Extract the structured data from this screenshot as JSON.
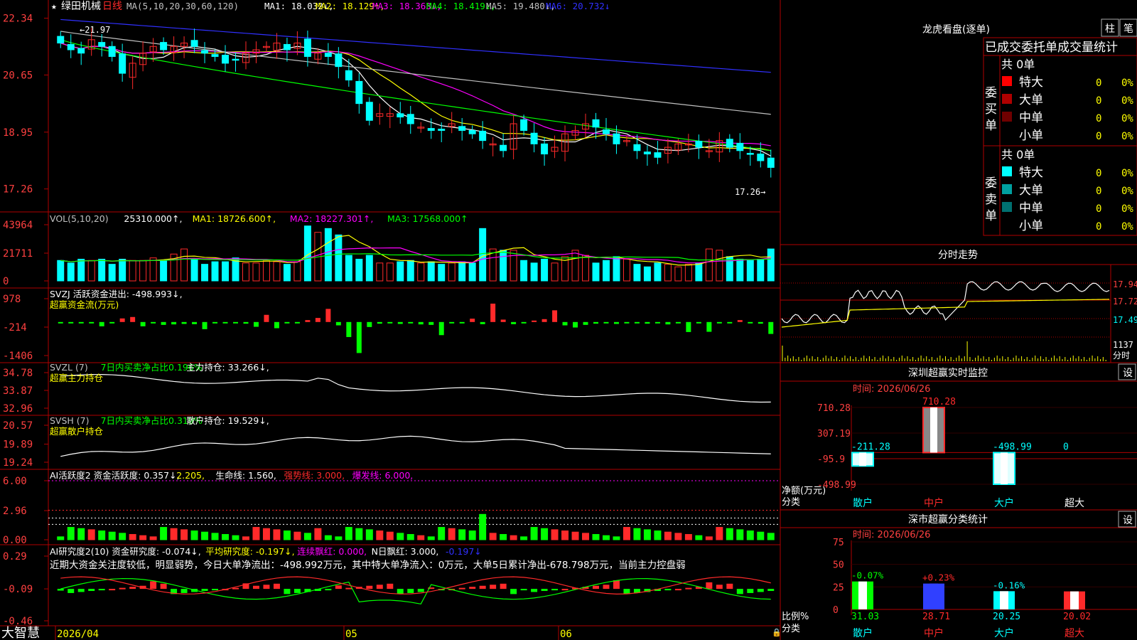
{
  "stock": {
    "name": "绿田机械",
    "period": "日线"
  },
  "colors": {
    "up": "#ff2a2a",
    "down": "#00ffff",
    "frame": "#b00000",
    "ma1": "#ffffff",
    "ma2": "#ffff00",
    "ma3": "#ff00ff",
    "ma4": "#00ff00",
    "ma5": "#c0c0c0",
    "ma6": "#3030ff",
    "bg": "#000000"
  },
  "price_panel": {
    "ma_legend": [
      {
        "label": "MA(5,10,20,30,60,120)",
        "color": "#c0c0c0"
      },
      {
        "label": "MA1: 18.032↓,",
        "color": "#ffffff"
      },
      {
        "label": "MA2: 18.129↑,",
        "color": "#ffff00"
      },
      {
        "label": "MA3: 18.363↓,",
        "color": "#ff00ff"
      },
      {
        "label": "MA4: 18.419↓,",
        "color": "#00ff00"
      },
      {
        "label": "MA5: 19.480↓,",
        "color": "#c0c0c0"
      },
      {
        "label": "MA6: 20.732↓",
        "color": "#3030ff"
      }
    ],
    "y_ticks": [
      "22.34",
      "20.65",
      "18.95",
      "17.26"
    ],
    "high_label": "←21.97",
    "low_label": "17.26→"
  },
  "vol_panel": {
    "legend": [
      {
        "label": "VOL(5,10,20)",
        "color": "#c0c0c0"
      },
      {
        "label": "25310.000↑,",
        "color": "#ffffff"
      },
      {
        "label": "MA1: 18726.600↑,",
        "color": "#ffff00"
      },
      {
        "label": "MA2: 18227.301↑,",
        "color": "#ff00ff"
      },
      {
        "label": "MA3: 17568.000↑",
        "color": "#00ff00"
      }
    ],
    "y_ticks": [
      "43964",
      "21711",
      "0"
    ]
  },
  "svzj_panel": {
    "legend": [
      {
        "label": "SVZJ  活跃资金进出: -498.993↓,",
        "color": "#ffffff"
      }
    ],
    "subtitle": "超赢资金流(万元)",
    "y_ticks": [
      "978",
      "-214",
      "-1406"
    ]
  },
  "svzl_panel": {
    "legend": [
      {
        "label": "SVZL (7)",
        "color": "#c0c0c0"
      },
      {
        "label": "7日内买卖净占比0.196%",
        "color": "#00ff00"
      },
      {
        "label": "主力持仓: 33.266↓,",
        "color": "#ffffff"
      }
    ],
    "subtitle": "超赢主力持仓",
    "y_ticks": [
      "34.78",
      "33.87",
      "32.96"
    ]
  },
  "svsh_panel": {
    "legend": [
      {
        "label": "SVSH (7)",
        "color": "#c0c0c0"
      },
      {
        "label": "7日内买卖净占比0.319%",
        "color": "#00ff00"
      },
      {
        "label": "散户持仓: 19.529↓,",
        "color": "#ffffff"
      }
    ],
    "subtitle": "超赢散户持仓",
    "y_ticks": [
      "20.57",
      "19.89",
      "19.24"
    ]
  },
  "ai_active_panel": {
    "legend": [
      {
        "label": "AI活跃度2 资金活跃度: 0.357↓,",
        "color": "#ffffff"
      },
      {
        "label": "2.205,",
        "color": "#ffff00"
      },
      {
        "label": "生命线: 1.560,",
        "color": "#ffffff"
      },
      {
        "label": "强势线: 3.000,",
        "color": "#ff2a2a"
      },
      {
        "label": "爆发线: 6.000,",
        "color": "#ff00ff"
      }
    ],
    "y_ticks": [
      "6.00",
      "2.96",
      "0.00"
    ]
  },
  "ai_research_panel": {
    "legend": [
      {
        "label": "AI研究度2(10) 资金研究度: -0.074↓,",
        "color": "#ffffff"
      },
      {
        "label": "平均研究度: -0.197↓,",
        "color": "#ffff00"
      },
      {
        "label": "连续飘红: 0.000,",
        "color": "#ff00ff"
      },
      {
        "label": "N日飘红: 3.000,",
        "color": "#ffffff"
      },
      {
        "label": "-0.197↓",
        "color": "#3030ff"
      }
    ],
    "comment": "近期大资金关注度较低，明显弱势，今日大单净流出：-498.992万元，其中特大单净流入：0万元，大单5日累计净出-678.798万元，当前主力控盘弱",
    "y_ticks": [
      "0.29",
      "-0.09",
      "-0.46"
    ]
  },
  "bottom_bar": {
    "brand": "大智慧",
    "dates": [
      "2026/04",
      "05",
      "06"
    ]
  },
  "dragon": {
    "title": "龙虎看盘(逐单)",
    "buttons": [
      "柱",
      "笔"
    ],
    "header": "已成交委托单成交量统计",
    "buy": {
      "label": "委买单",
      "count": "共 0单",
      "rows": [
        {
          "name": "特大",
          "vol": "0",
          "pct": "0%",
          "color": "#ff0000"
        },
        {
          "name": "大单",
          "vol": "0",
          "pct": "0%",
          "color": "#b00000"
        },
        {
          "name": "中单",
          "vol": "0",
          "pct": "0%",
          "color": "#700000"
        },
        {
          "name": "小单",
          "vol": "0",
          "pct": "0%",
          "color": ""
        }
      ]
    },
    "sell": {
      "label": "委卖单",
      "count": "共 0单",
      "rows": [
        {
          "name": "特大",
          "vol": "0",
          "pct": "0%",
          "color": "#00ffff"
        },
        {
          "name": "大单",
          "vol": "0",
          "pct": "0%",
          "color": "#00a0a0"
        },
        {
          "name": "中单",
          "vol": "0",
          "pct": "0%",
          "color": "#007070"
        },
        {
          "name": "小单",
          "vol": "0",
          "pct": "0%",
          "color": ""
        }
      ]
    }
  },
  "intraday": {
    "title": "分时走势",
    "prices": [
      "17.94",
      "17.72",
      "17.49"
    ],
    "vol_max": "1137",
    "unit": "分时"
  },
  "monitor": {
    "title": "深圳超赢实时监控",
    "settings": "设",
    "date": "时间: 2026/06/26",
    "y_ticks": [
      "710.28",
      "307.19",
      "-95.9",
      "-498.99"
    ],
    "ylabel": "净额(万元)",
    "xlabel": "分类",
    "categories": [
      "散户",
      "中户",
      "大户",
      "超大"
    ],
    "values": [
      -211.28,
      710.28,
      -498.99,
      0
    ],
    "value_labels": [
      "-211.28",
      "710.28",
      "-498.99",
      "0"
    ]
  },
  "class_stats": {
    "title": "深市超赢分类统计",
    "settings": "设",
    "date": "时间: 2026/06/26",
    "y_ticks": [
      "75",
      "50",
      "25",
      "0"
    ],
    "ylabel": "比例%",
    "xlabel": "分类",
    "categories": [
      "散户",
      "中户",
      "大户",
      "超大"
    ],
    "values": [
      31.03,
      28.71,
      20.25,
      20.02
    ],
    "changes": [
      "-0.07%",
      "+0.23%",
      "-0.16%",
      ""
    ],
    "value_labels": [
      "31.03",
      "28.71",
      "20.25",
      "20.02"
    ]
  },
  "chart_data": [
    {
      "type": "candlestick",
      "title": "绿田机械 日线",
      "x": [
        "2026/04",
        "05",
        "06"
      ],
      "ylim": [
        17.0,
        22.5
      ],
      "ma_values": {
        "MA1": 18.032,
        "MA2": 18.129,
        "MA3": 18.363,
        "MA4": 18.419,
        "MA5": 19.48,
        "MA6": 20.732
      },
      "high": 21.97,
      "low": 17.26,
      "close": [
        21.6,
        21.4,
        21.3,
        21.7,
        21.5,
        21.2,
        20.7,
        21.0,
        21.3,
        21.5,
        21.4,
        21.5,
        21.6,
        21.5,
        21.3,
        21.2,
        21.0,
        21.1,
        21.3,
        21.4,
        21.5,
        21.6,
        21.4,
        21.6,
        21.2,
        21.3,
        21.2,
        20.9,
        20.5,
        19.8,
        19.3,
        19.5,
        19.5,
        19.4,
        19.2,
        19.1,
        19.0,
        19.0,
        19.2,
        19.0,
        18.9,
        18.7,
        18.6,
        18.4,
        19.2,
        19.0,
        18.6,
        18.3,
        18.5,
        18.9,
        19.0,
        19.2,
        19.1,
        18.9,
        18.6,
        18.7,
        18.4,
        18.3,
        18.2,
        18.5,
        18.6,
        18.6,
        18.5,
        18.4,
        18.7,
        18.5,
        18.4,
        18.3,
        18.1,
        17.9
      ]
    },
    {
      "type": "bar",
      "title": "VOL(5,10,20)",
      "ylim": [
        0,
        43964
      ],
      "values": [
        16000,
        14000,
        17000,
        16000,
        17000,
        13000,
        17000,
        16000,
        16000,
        18000,
        16000,
        21000,
        25000,
        17000,
        13000,
        15000,
        15000,
        18000,
        14000,
        14000,
        16000,
        15000,
        13000,
        15000,
        43000,
        38000,
        41000,
        36000,
        20000,
        17000,
        20000,
        14000,
        14000,
        15000,
        16000,
        14000,
        15000,
        13000,
        14000,
        15000,
        14000,
        41000,
        25000,
        24000,
        24000,
        16000,
        14000,
        17000,
        14000,
        19000,
        24000,
        20000,
        14000,
        16000,
        19000,
        17000,
        13000,
        11000,
        14000,
        13000,
        11000,
        13000,
        14000,
        25000,
        24000,
        19000,
        17000,
        16000,
        17000,
        25000
      ]
    },
    {
      "type": "bar",
      "title": "SVZJ 活跃资金进出",
      "ylim": [
        -1406,
        978
      ],
      "values": [
        -30,
        -20,
        -50,
        -30,
        -180,
        -50,
        150,
        210,
        -180,
        -40,
        -120,
        -100,
        -80,
        -90,
        -300,
        -60,
        -50,
        -20,
        -70,
        -200,
        300,
        -260,
        -50,
        -40,
        80,
        170,
        550,
        -140,
        -630,
        -1300,
        -210,
        -70,
        -30,
        -80,
        -20,
        -100,
        -120,
        -550,
        -40,
        -20,
        140,
        -90,
        770,
        100,
        -90,
        -30,
        60,
        120,
        490,
        -140,
        -230,
        -120,
        -70,
        -60,
        -80,
        -50,
        -30,
        -70,
        -40,
        -100,
        -60,
        -420,
        -50,
        -410,
        -40,
        -30,
        80,
        -50,
        -70,
        -500
      ]
    },
    {
      "type": "line",
      "title": "SVZL 主力持仓",
      "ylim": [
        32.96,
        34.78
      ],
      "last": 33.266
    },
    {
      "type": "line",
      "title": "SVSH 散户持仓",
      "ylim": [
        19.24,
        20.57
      ],
      "last": 19.529
    },
    {
      "type": "bar",
      "title": "AI活跃度2",
      "ylim": [
        0,
        6.0
      ],
      "lines": {
        "生命线": 1.56,
        "强势线": 3.0,
        "爆发线": 6.0
      },
      "last": 0.357
    },
    {
      "type": "bar",
      "title": "AI研究度2(10)",
      "ylim": [
        -0.46,
        0.29
      ],
      "last": -0.074
    }
  ]
}
